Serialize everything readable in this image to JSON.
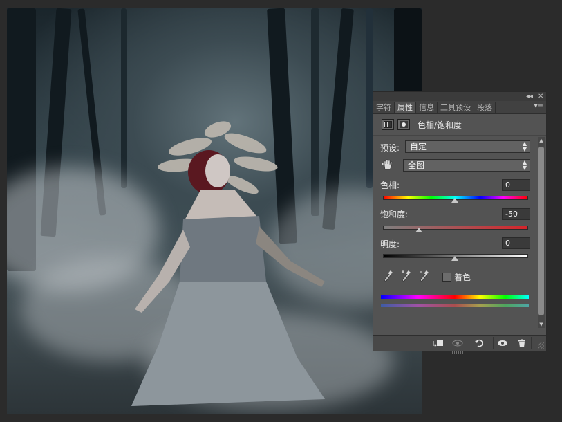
{
  "panel": {
    "tabs": [
      {
        "label": "字符",
        "active": false
      },
      {
        "label": "属性",
        "active": true
      },
      {
        "label": "信息",
        "active": false
      },
      {
        "label": "工具预设",
        "active": false
      },
      {
        "label": "段落",
        "active": false
      }
    ],
    "title": "色相/饱和度",
    "preset_label": "预设:",
    "preset_value": "自定",
    "channel_value": "全图",
    "hue_label": "色相:",
    "hue_value": "0",
    "hue_level": 0.5,
    "saturation_label": "饱和度:",
    "saturation_value": "-50",
    "saturation_level": 0.25,
    "lightness_label": "明度:",
    "lightness_value": "0",
    "lightness_level": 0.5,
    "colorize_label": "着色",
    "colorize_checked": false
  },
  "icons": {
    "collapse": "double-chevron-icon",
    "close": "close-icon",
    "menu": "panel-menu-icon",
    "adjustment": "adjustment-layer-icon",
    "mask": "mask-icon",
    "hand": "targeted-adjust-hand-icon",
    "eyedroppers": [
      "eyedropper-icon",
      "eyedropper-plus-icon",
      "eyedropper-minus-icon"
    ],
    "bottom": [
      "clip-to-layer-icon",
      "view-previous-state-icon",
      "reset-icon",
      "visibility-eye-icon",
      "trash-icon"
    ]
  },
  "colors": {
    "panel_bg": "#535353",
    "tab_bg": "#414141",
    "field_bg": "#3a3a3a",
    "saturation_track_end": "#d6242a"
  }
}
